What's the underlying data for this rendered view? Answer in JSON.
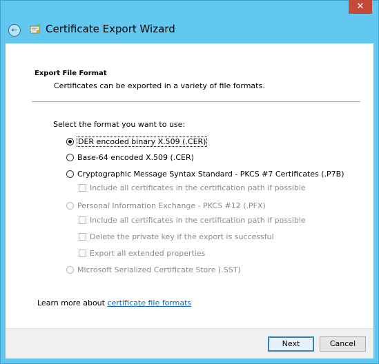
{
  "window": {
    "close_glyph": "✕"
  },
  "header": {
    "title": "Certificate Export Wizard",
    "back_glyph": "←"
  },
  "section": {
    "title": "Export File Format",
    "description": "Certificates can be exported in a variety of file formats."
  },
  "prompt": "Select the format you want to use:",
  "options": {
    "der": {
      "label": "DER encoded binary X.509 (.CER)",
      "selected": true,
      "enabled": true
    },
    "base64": {
      "label": "Base-64 encoded X.509 (.CER)",
      "selected": false,
      "enabled": true
    },
    "pkcs7": {
      "label": "Cryptographic Message Syntax Standard - PKCS #7 Certificates (.P7B)",
      "selected": false,
      "enabled": true
    },
    "pkcs7_include_all": {
      "label": "Include all certificates in the certification path if possible",
      "checked": false,
      "enabled": false
    },
    "pfx": {
      "label": "Personal Information Exchange - PKCS #12 (.PFX)",
      "selected": false,
      "enabled": false
    },
    "pfx_include_all": {
      "label": "Include all certificates in the certification path if possible",
      "checked": false,
      "enabled": false
    },
    "pfx_delete_key": {
      "label": "Delete the private key if the export is successful",
      "checked": false,
      "enabled": false
    },
    "pfx_export_ext": {
      "label": "Export all extended properties",
      "checked": false,
      "enabled": false
    },
    "sst": {
      "label": "Microsoft Serialized Certificate Store (.SST)",
      "selected": false,
      "enabled": false
    }
  },
  "learn_more": {
    "prefix": "Learn more about ",
    "link": "certificate file formats"
  },
  "buttons": {
    "next": "Next",
    "cancel": "Cancel"
  },
  "colors": {
    "frame": "#63c8ef",
    "close": "#c74a39",
    "link": "#0b64c8"
  }
}
